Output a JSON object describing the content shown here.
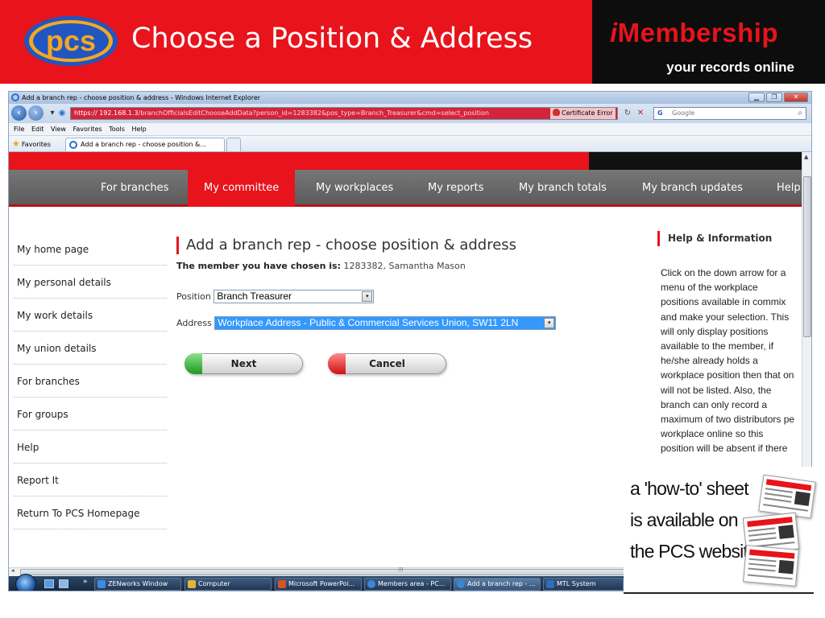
{
  "slide": {
    "title": "Choose a Position & Address",
    "logo_text": "pcs",
    "brand_i": "i",
    "brand_name": "Membership",
    "brand_tagline": "your records online",
    "colors": {
      "red": "#e8131b",
      "black": "#0d0d0d",
      "pcs_blue": "#1f56c2",
      "pcs_orange": "#f5a623"
    }
  },
  "browser": {
    "window_title": "Add a branch rep - choose position & address - Windows Internet Explorer",
    "address_host": "https://  192.168.1.3",
    "address_path": "/branchOfficialsEditChooseAddData?person_id=1283382&pos_type=Branch_Treasurer&cmd=select_position",
    "cert_error": "Certificate Error",
    "search_placeholder": "Google",
    "menu": [
      "File",
      "Edit",
      "View",
      "Favorites",
      "Tools",
      "Help"
    ],
    "favorites_label": "Favorites",
    "tab_label": "Add a branch rep - choose position &..."
  },
  "site": {
    "nav": [
      "For branches",
      "My committee",
      "My workplaces",
      "My reports",
      "My branch totals",
      "My branch updates",
      "Help"
    ],
    "active_nav": "My committee",
    "sidebar": [
      "My home page",
      "My personal details",
      "My work details",
      "My union details",
      "For branches",
      "For groups",
      "Help",
      "Report It",
      "Return To PCS Homepage"
    ],
    "heading": "Add a branch rep - choose position & address",
    "member_label": "The member you have chosen is:",
    "member_value": " 1283382,  Samantha Mason",
    "position_label": "Position",
    "position_value": "Branch Treasurer",
    "address_label": "Address",
    "address_value": "Workplace Address - Public & Commercial Services Union, SW11 2LN",
    "next_button": "Next",
    "cancel_button": "Cancel",
    "help_title": "Help & Information",
    "help_text": "Click on the down arrow for a\nmenu of the workplace\npositions available in commix\nand make your selection.   This\nwill only display positions\navailable to the member, if\nhe/she already holds a\nworkplace position then that on\nwill not be listed.  Also, the\nbranch can only record a\nmaximum of two distributors pe\nworkplace online so this\nposition will be absent if there"
  },
  "taskbar": {
    "items": [
      "ZENworks Window",
      "Computer",
      "Microsoft PowerPoi...",
      "Members area - PC...",
      "Add a branch rep - ...",
      "MTL System"
    ]
  },
  "howto": {
    "text": "a 'how-to' sheet\nis available on\nthe PCS website"
  }
}
